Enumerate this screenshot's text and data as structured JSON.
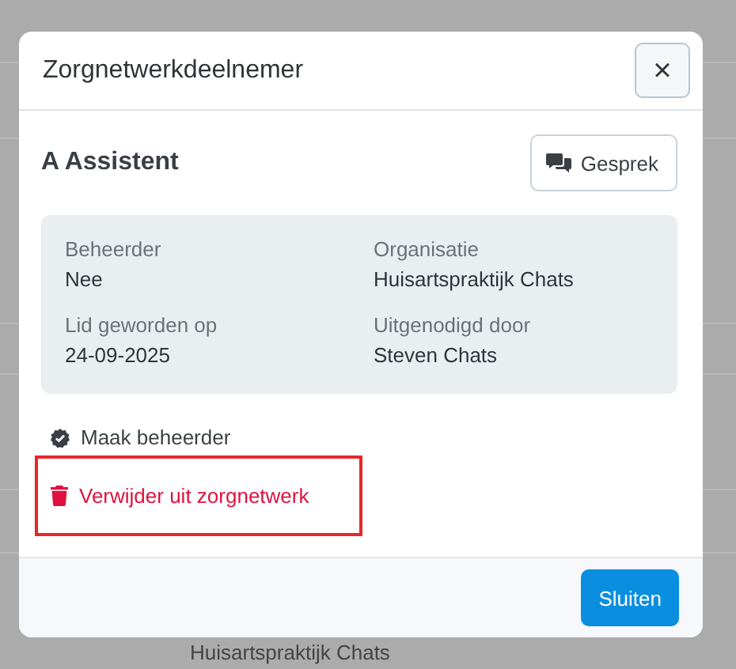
{
  "background": {
    "cell": "Huisartspraktijk Chats"
  },
  "dialog": {
    "title": "Zorgnetwerkdeelnemer",
    "close_label": "×",
    "member_name": "A Assistent",
    "chat_button": "Gesprek",
    "details": [
      {
        "label": "Beheerder",
        "value": "Nee"
      },
      {
        "label": "Organisatie",
        "value": "Huisartspraktijk Chats"
      },
      {
        "label": "Lid geworden op",
        "value": "24-09-2025"
      },
      {
        "label": "Uitgenodigd door",
        "value": "Steven Chats"
      }
    ],
    "actions": [
      {
        "kind": "make_admin",
        "label": "Maak beheerder",
        "highlighted": false
      },
      {
        "kind": "remove",
        "label": "Verwijder uit zorgnetwerk",
        "highlighted": true
      }
    ],
    "footer_button": "Sluiten"
  }
}
